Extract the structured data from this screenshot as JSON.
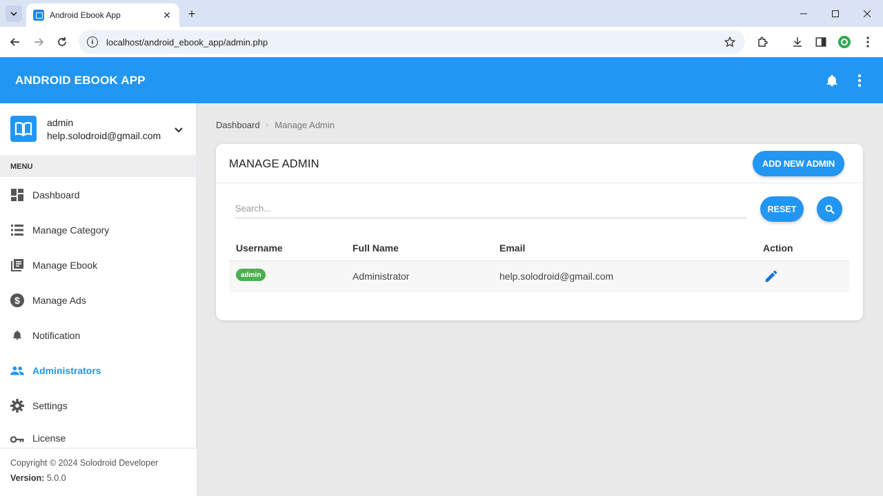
{
  "browser": {
    "tab_title": "Android Ebook App",
    "url": "localhost/android_ebook_app/admin.php"
  },
  "app": {
    "title": "ANDROID EBOOK APP"
  },
  "user": {
    "name": "admin",
    "email": "help.solodroid@gmail.com"
  },
  "sidebar": {
    "menu_header": "MENU",
    "items": [
      {
        "label": "Dashboard",
        "icon": "dashboard-icon"
      },
      {
        "label": "Manage Category",
        "icon": "list-icon"
      },
      {
        "label": "Manage Ebook",
        "icon": "library-books-icon"
      },
      {
        "label": "Manage Ads",
        "icon": "dollar-icon"
      },
      {
        "label": "Notification",
        "icon": "bell-icon"
      },
      {
        "label": "Administrators",
        "icon": "people-icon",
        "active": true
      },
      {
        "label": "Settings",
        "icon": "gear-icon"
      },
      {
        "label": "License",
        "icon": "key-icon"
      }
    ],
    "footer_copyright": "Copyright © 2024 Solodroid Developer",
    "footer_version_label": "Version:",
    "footer_version": "5.0.0"
  },
  "breadcrumb": {
    "home": "Dashboard",
    "current": "Manage Admin"
  },
  "card": {
    "title": "MANAGE ADMIN",
    "add_button": "ADD NEW ADMIN",
    "search_placeholder": "Search...",
    "reset_button": "RESET"
  },
  "table": {
    "headers": [
      "Username",
      "Full Name",
      "Email",
      "Action"
    ],
    "rows": [
      {
        "username": "admin",
        "full_name": "Administrator",
        "email": "help.solodroid@gmail.com"
      }
    ]
  },
  "colors": {
    "primary": "#2196f3",
    "badge": "#4caf50"
  }
}
